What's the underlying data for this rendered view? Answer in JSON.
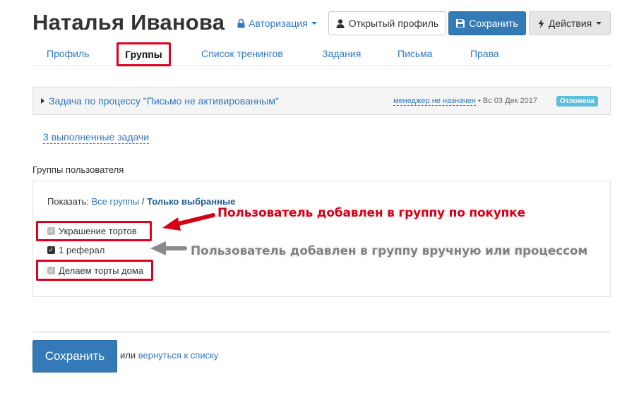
{
  "header": {
    "user_name": "Наталья Иванова",
    "auth_label": "Авторизация",
    "open_profile_label": "Открытый профиль",
    "save_label": "Сохранить",
    "actions_label": "Действия"
  },
  "tabs": {
    "profile": "Профиль",
    "groups": "Группы",
    "trainings": "Список тренингов",
    "tasks": "Задания",
    "letters": "Письма",
    "rights": "Права"
  },
  "task": {
    "title": "Задача по процессу \"Письмо не активированным\"",
    "manager": "менеджер не назначен",
    "date": " • Вс 03 Дек 2017",
    "status": "Отложена"
  },
  "done_tasks_link": "3 выполненные задачи",
  "groups_section": {
    "label": "Группы пользователя",
    "show_prefix": "Показать:",
    "all_groups": "Все группы",
    "separator": " / ",
    "only_selected": "Только выбранные",
    "items": [
      {
        "label": "Украшение тортов",
        "checked": true,
        "disabled": true
      },
      {
        "label": "1 реферал",
        "checked": true,
        "disabled": false
      },
      {
        "label": "Делаем торты дома",
        "checked": true,
        "disabled": true
      }
    ]
  },
  "annotations": {
    "purchase": "Пользователь добавлен в группу по покупке",
    "manual": "Пользователь добавлен в группу вручную или процессом"
  },
  "footer": {
    "save_label": "Сохранить",
    "or_text": "или",
    "back_link": "вернуться к списку"
  },
  "colors": {
    "primary": "#337ab7",
    "link": "#2f78c4",
    "highlight": "#e0001b",
    "badge": "#5bc0de",
    "annotation_gray": "#808080"
  }
}
